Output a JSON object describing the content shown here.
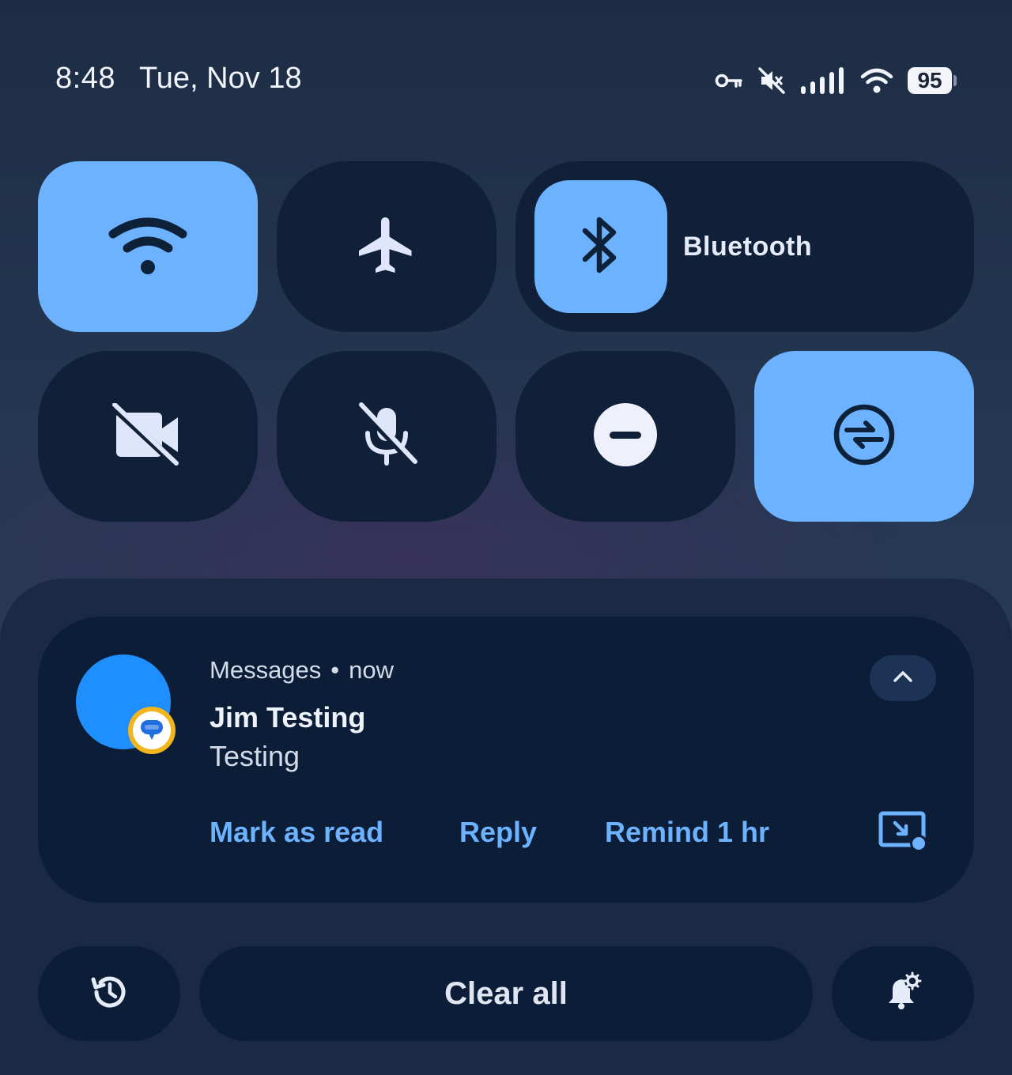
{
  "status_bar": {
    "time": "8:48",
    "date": "Tue, Nov 18",
    "icons": [
      "vpn-key-icon",
      "vibrate-off-icon",
      "cellular-signal-icon",
      "wifi-signal-icon"
    ],
    "battery_level": "95"
  },
  "quick_settings": {
    "tiles": [
      {
        "name": "wifi",
        "icon": "wifi-icon",
        "active": true
      },
      {
        "name": "airplane-mode",
        "icon": "airplane-icon",
        "active": false
      },
      {
        "name": "bluetooth",
        "icon": "bluetooth-icon",
        "label": "Bluetooth",
        "active": true
      },
      {
        "name": "camera-access",
        "icon": "camera-off-icon",
        "active": false
      },
      {
        "name": "mic-access",
        "icon": "mic-off-icon",
        "active": false
      },
      {
        "name": "do-not-disturb",
        "icon": "do-not-disturb-icon",
        "active": false
      },
      {
        "name": "auto-rotate",
        "icon": "sync-icon",
        "active": true
      }
    ]
  },
  "notification": {
    "app_name": "Messages",
    "separator": "•",
    "time": "now",
    "title": "Jim Testing",
    "text": "Testing",
    "actions": {
      "mark_read": "Mark as read",
      "reply": "Reply",
      "remind": "Remind 1 hr"
    }
  },
  "footer": {
    "clear_all": "Clear all"
  },
  "colors": {
    "accent": "#6cb2ff",
    "tile_inactive": "#102039",
    "card": "#0c1d38",
    "avatar": "#1f8fff",
    "badge_ring": "#f2b51d"
  }
}
